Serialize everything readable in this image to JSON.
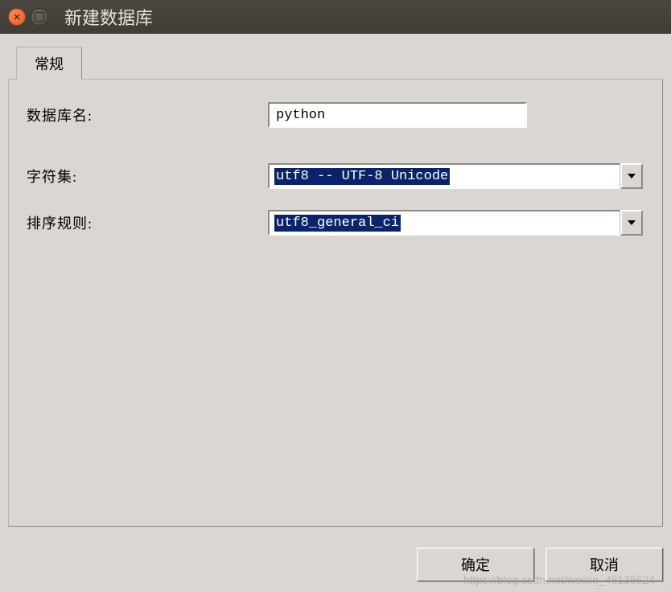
{
  "window": {
    "title": "新建数据库"
  },
  "tab": {
    "general_label": "常规"
  },
  "form": {
    "db_name_label": "数据库名:",
    "db_name_value": "python",
    "charset_label": "字符集:",
    "charset_value": "utf8 -- UTF-8 Unicode",
    "collation_label": "排序规则:",
    "collation_value": "utf8_general_ci"
  },
  "buttons": {
    "ok_label": "确定",
    "cancel_label": "取消"
  },
  "watermark": "https://blog.csdn.net/weixin_48135624"
}
